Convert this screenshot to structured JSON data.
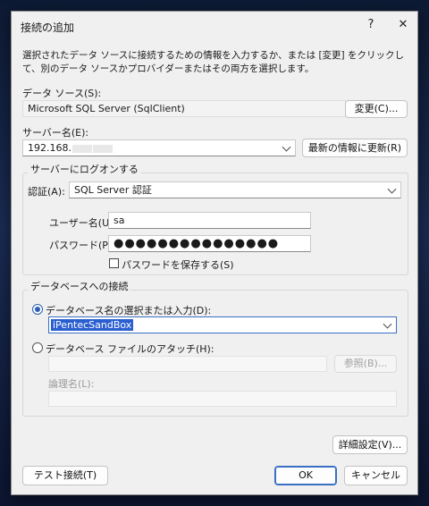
{
  "window": {
    "title": "接続の追加",
    "help_glyph": "?",
    "close_glyph": "✕"
  },
  "description": "選択されたデータ ソースに接続するための情報を入力するか、または [変更] をクリックして、別のデータ ソースかプロバイダーまたはその両方を選択します。",
  "data_source": {
    "label": "データ ソース(S):",
    "value": "Microsoft SQL Server (SqlClient)",
    "change_button": "変更(C)..."
  },
  "server": {
    "label": "サーバー名(E):",
    "value": "192.168.",
    "refresh_button": "最新の情報に更新(R)"
  },
  "logon": {
    "group_title": "サーバーにログオンする",
    "auth_label": "認証(A):",
    "auth_value": "SQL Server 認証",
    "user_label": "ユーザー名(U):",
    "user_value": "sa",
    "password_label": "パスワード(P):",
    "password_value": "●●●●●●●●●●●●●●●",
    "save_password_label": "パスワードを保存する(S)",
    "save_password_checked": false
  },
  "database": {
    "group_title": "データベースへの接続",
    "select_radio_label": "データベース名の選択または入力(D):",
    "select_radio_checked": true,
    "db_name_value": "iPentecSandBox",
    "attach_radio_label": "データベース ファイルのアタッチ(H):",
    "attach_radio_checked": false,
    "browse_button": "参照(B)...",
    "logical_name_label": "論理名(L):"
  },
  "buttons": {
    "advanced": "詳細設定(V)...",
    "test": "テスト接続(T)",
    "ok": "OK",
    "cancel": "キャンセル"
  },
  "colors": {
    "accent": "#2b5fd0",
    "dialog_bg": "#f0f0f0"
  }
}
